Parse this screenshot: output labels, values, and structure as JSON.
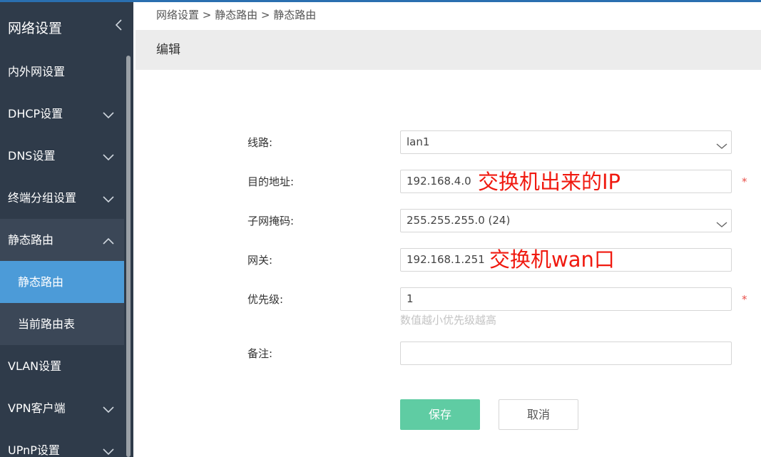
{
  "colors": {
    "sidebar_bg": "#2f3b4a",
    "sidebar_active": "#4c9bd8",
    "save_button": "#5fcca3",
    "annotation": "#f0190f",
    "required_mark": "#e8504a"
  },
  "sidebar": {
    "title": "网络设置",
    "collapse_icon": "chevron-left-icon",
    "items": [
      {
        "label": "内外网设置"
      },
      {
        "label": "DHCP设置",
        "icon": "chevron-down-icon"
      },
      {
        "label": "DNS设置",
        "icon": "chevron-down-icon"
      },
      {
        "label": "终端分组设置",
        "icon": "chevron-down-icon"
      },
      {
        "label": "静态路由",
        "icon": "chevron-up-icon",
        "expanded": true
      },
      {
        "label": "VLAN设置"
      },
      {
        "label": "VPN客户端",
        "icon": "chevron-down-icon"
      },
      {
        "label": "UPnP设置",
        "icon": "chevron-down-icon"
      }
    ],
    "subitems": [
      {
        "label": "静态路由",
        "active": true
      },
      {
        "label": "当前路由表"
      }
    ]
  },
  "breadcrumb": "网络设置 > 静态路由 > 静态路由",
  "edit_title": "编辑",
  "form": {
    "line": {
      "label": "线路:",
      "value": "lan1"
    },
    "dest": {
      "label": "目的地址:",
      "value": "192.168.4.0",
      "required": "*"
    },
    "mask": {
      "label": "子网掩码:",
      "value": "255.255.255.0 (24)"
    },
    "gateway": {
      "label": "网关:",
      "value": "192.168.1.251"
    },
    "priority": {
      "label": "优先级:",
      "value": "1",
      "required": "*",
      "hint": "数值越小优先级越高"
    },
    "note": {
      "label": "备注:",
      "value": ""
    }
  },
  "annotations": {
    "dest": "交换机出来的IP",
    "gateway": "交换机wan口"
  },
  "buttons": {
    "save": "保存",
    "cancel": "取消"
  }
}
